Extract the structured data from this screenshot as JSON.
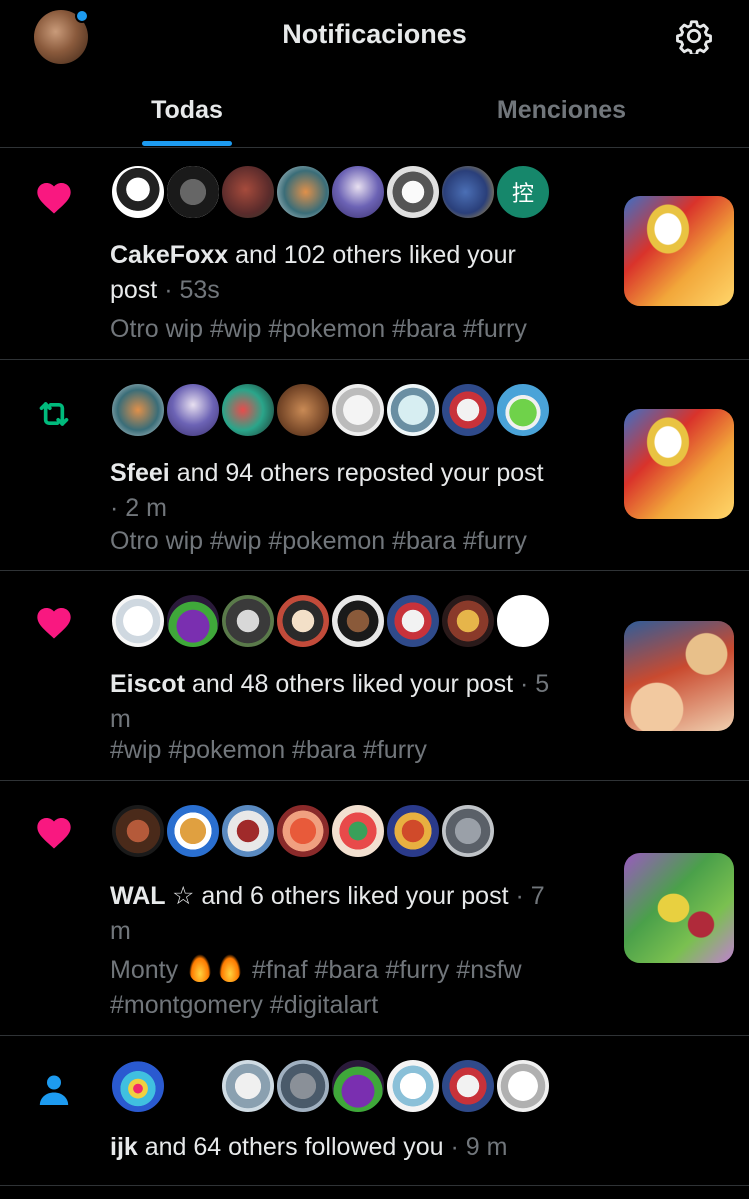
{
  "header": {
    "title": "Notificaciones",
    "settings_icon": "gear-icon",
    "avatar_badge_color": "#1d9bf0"
  },
  "tabs": [
    {
      "label": "Todas",
      "active": true
    },
    {
      "label": "Menciones",
      "active": false
    }
  ],
  "notifications": [
    {
      "type": "like",
      "icon": "heart-icon",
      "actor": "CakeFoxx",
      "text": " and 102 others liked your post",
      "time_line1": "post",
      "time": " · 53s",
      "preview": "Otro wip #wip #pokemon #bara #furry",
      "avatar_glyph": "控"
    },
    {
      "type": "repost",
      "icon": "repost-icon",
      "actor": "Sfeei",
      "text": " and 94 others reposted your post",
      "time": "· 2 m",
      "preview": "Otro wip #wip #pokemon #bara #furry"
    },
    {
      "type": "like",
      "icon": "heart-icon",
      "actor": "Eiscot",
      "text": " and 48 others liked your post",
      "time": " · 5",
      "time_line2": "m",
      "preview": "#wip #pokemon #bara #furry"
    },
    {
      "type": "like",
      "icon": "heart-icon",
      "actor": "WAL ☆",
      "text": " and 6 others liked your post",
      "time": " · 7",
      "time_line2": "m",
      "preview_a": "Monty",
      "preview_b": "#fnaf #bara #furry #nsfw",
      "preview_c": "#montgomery #digitalart"
    },
    {
      "type": "follow",
      "icon": "person-icon",
      "actor": "ijk",
      "text": " and 64 others followed you",
      "time": " · 9 m"
    }
  ],
  "colors": {
    "like": "#f91880",
    "repost": "#00ba7c",
    "follow": "#1d9bf0",
    "muted": "#71767b"
  }
}
